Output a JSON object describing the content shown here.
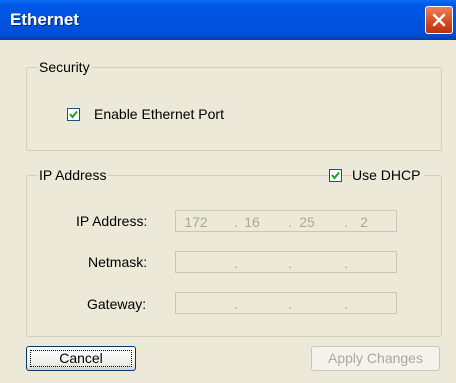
{
  "window": {
    "title": "Ethernet"
  },
  "security": {
    "legend": "Security",
    "enable_port": {
      "label": "Enable Ethernet Port",
      "checked": true
    }
  },
  "ip": {
    "legend": "IP Address",
    "use_dhcp": {
      "label": "Use DHCP",
      "checked": true
    },
    "fields": {
      "ip_address": {
        "label": "IP Address:",
        "octets": [
          "172",
          "16",
          "25",
          "2"
        ]
      },
      "netmask": {
        "label": "Netmask:",
        "octets": [
          "",
          "",
          "",
          ""
        ]
      },
      "gateway": {
        "label": "Gateway:",
        "octets": [
          "",
          "",
          "",
          ""
        ]
      }
    },
    "separator": "."
  },
  "buttons": {
    "cancel": "Cancel",
    "apply": "Apply Changes"
  },
  "icons": {
    "close": "close-icon",
    "check": "checkmark-icon"
  }
}
